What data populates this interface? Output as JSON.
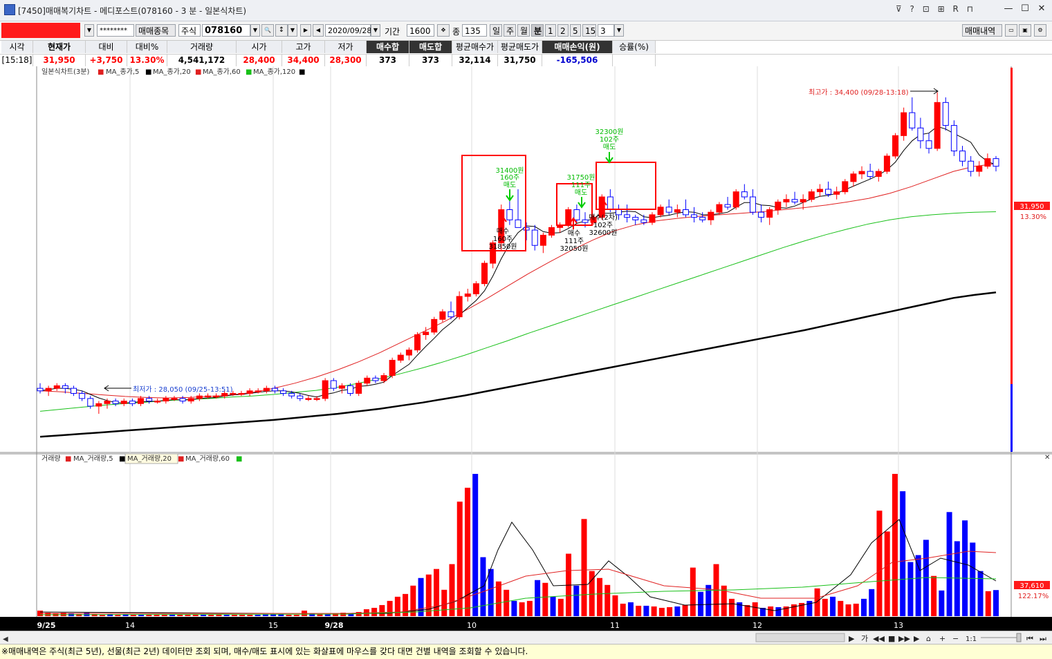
{
  "window": {
    "title": "[7450]매매복기차트 - 메디포스트(078160 - 3 분 - 일본식차트)",
    "icons": "⊽ ? ⊡ ⊞ R ⊓"
  },
  "toolbar": {
    "password": "********",
    "trade_items_btn": "매매종목",
    "market_select": "주식",
    "stock_code": "078160",
    "date": "2020/09/28",
    "period_label": "기간",
    "period_value": "1600",
    "count_label": "종",
    "count_value": "135",
    "period_buttons": [
      "일",
      "주",
      "월",
      "분",
      "1",
      "2",
      "5",
      "15"
    ],
    "interval_value": "3",
    "trade_history_btn": "매매내역"
  },
  "info": {
    "headers": [
      "시각",
      "현재가",
      "대비",
      "대비%",
      "거래량",
      "시가",
      "고가",
      "저가",
      "매수합",
      "매도합",
      "평균매수가",
      "평균매도가",
      "매매손익(원)",
      "승률(%)"
    ],
    "values": [
      "[15:18]",
      "31,950",
      "+3,750",
      "13.30%",
      "4,541,172",
      "28,400",
      "34,400",
      "28,300",
      "373",
      "373",
      "32,114",
      "31,750",
      "-165,506",
      ""
    ]
  },
  "price_legend": {
    "title": "일본식차트(3분)",
    "items": [
      "MA_종가,5",
      "MA_종가,20",
      "MA_종가,60",
      "MA_종가,120"
    ]
  },
  "volume_legend": {
    "title": "거래량",
    "items": [
      "MA_거래량,5",
      "MA_거래량,20",
      "MA_거래량,60"
    ]
  },
  "annotations": {
    "high": "최고가 : 34,400 (09/28-13:18)",
    "low": "최저가 : 28,050 (09/25-13:51)",
    "sell1": [
      "31400원",
      "160주",
      "매도"
    ],
    "buy1": [
      "매수",
      "160주",
      "31850원"
    ],
    "sell2": [
      "31750원",
      "111주",
      "매도"
    ],
    "buy2": [
      "매수",
      "111주",
      "32050원"
    ],
    "sell3": [
      "32300원",
      "102주",
      "매도"
    ],
    "buy3": [
      "매수(2차)",
      "102주",
      "32600원"
    ]
  },
  "price_tag": {
    "value": "31,950",
    "pct": "13.30%"
  },
  "volume_tag": {
    "value": "37,610",
    "pct": "122.17%"
  },
  "time_labels": [
    "9/25",
    "14",
    "15",
    "9/28",
    "10",
    "11",
    "12",
    "13"
  ],
  "scroll": {
    "ratio": "1:1"
  },
  "footer_text": "※매매내역은 주식(최근 5년), 선물(최근 2년) 데이터만 조회 되며, 매수/매도 표시에 있는 화살표에 마우스를 갖다 대면 건별 내역을 조회할 수 있습니다.",
  "colors": {
    "up": "#ff0000",
    "down": "#0000ff",
    "ma5": "#000000",
    "ma20": "#e02020",
    "ma60": "#18c018",
    "ma120": "#000000",
    "green": "#00cc00"
  },
  "chart_data": {
    "type": "candlestick",
    "ylim": [
      27600,
      34800
    ],
    "up_color": "#ff0000",
    "down_color": "#0000ff",
    "candles": [
      [
        28600,
        28700,
        28500,
        28550
      ],
      [
        28550,
        28650,
        28450,
        28600
      ],
      [
        28600,
        28700,
        28550,
        28650
      ],
      [
        28650,
        28700,
        28500,
        28600
      ],
      [
        28600,
        28650,
        28450,
        28500
      ],
      [
        28500,
        28550,
        28350,
        28400
      ],
      [
        28400,
        28450,
        28200,
        28250
      ],
      [
        28250,
        28350,
        28100,
        28300
      ],
      [
        28300,
        28400,
        28200,
        28350
      ],
      [
        28350,
        28400,
        28250,
        28300
      ],
      [
        28300,
        28400,
        28250,
        28350
      ],
      [
        28350,
        28400,
        28250,
        28300
      ],
      [
        28300,
        28450,
        28250,
        28400
      ],
      [
        28400,
        28450,
        28300,
        28350
      ],
      [
        28350,
        28400,
        28300,
        28350
      ],
      [
        28350,
        28450,
        28300,
        28400
      ],
      [
        28400,
        28450,
        28350,
        28400
      ],
      [
        28400,
        28450,
        28300,
        28350
      ],
      [
        28350,
        28450,
        28300,
        28400
      ],
      [
        28400,
        28500,
        28350,
        28450
      ],
      [
        28450,
        28500,
        28400,
        28450
      ],
      [
        28450,
        28500,
        28400,
        28450
      ],
      [
        28450,
        28550,
        28400,
        28500
      ],
      [
        28500,
        28550,
        28450,
        28500
      ],
      [
        28500,
        28550,
        28450,
        28500
      ],
      [
        28500,
        28600,
        28450,
        28550
      ],
      [
        28550,
        28600,
        28500,
        28550
      ],
      [
        28550,
        28650,
        28500,
        28600
      ],
      [
        28600,
        28650,
        28500,
        28550
      ],
      [
        28550,
        28600,
        28450,
        28500
      ],
      [
        28500,
        28550,
        28400,
        28450
      ],
      [
        28450,
        28500,
        28350,
        28400
      ],
      [
        28400,
        28450,
        28350,
        28400
      ],
      [
        28400,
        28450,
        28350,
        28400
      ],
      [
        28400,
        28800,
        28350,
        28750
      ],
      [
        28750,
        28800,
        28550,
        28600
      ],
      [
        28600,
        28700,
        28500,
        28650
      ],
      [
        28650,
        28700,
        28450,
        28500
      ],
      [
        28500,
        28750,
        28450,
        28700
      ],
      [
        28700,
        28850,
        28650,
        28800
      ],
      [
        28800,
        28850,
        28700,
        28750
      ],
      [
        28750,
        28900,
        28700,
        28850
      ],
      [
        28850,
        29200,
        28800,
        29150
      ],
      [
        29150,
        29300,
        29100,
        29250
      ],
      [
        29250,
        29400,
        29150,
        29350
      ],
      [
        29350,
        29700,
        29300,
        29650
      ],
      [
        29650,
        29800,
        29550,
        29700
      ],
      [
        29700,
        30000,
        29650,
        29950
      ],
      [
        29950,
        30150,
        29900,
        30100
      ],
      [
        30100,
        30300,
        29950,
        30000
      ],
      [
        30000,
        30500,
        29950,
        30400
      ],
      [
        30400,
        30550,
        30300,
        30450
      ],
      [
        30450,
        30700,
        30400,
        30650
      ],
      [
        30650,
        31100,
        30600,
        31050
      ],
      [
        31050,
        31500,
        30950,
        31450
      ],
      [
        31450,
        32200,
        31300,
        32100
      ],
      [
        32100,
        32400,
        31800,
        31900
      ],
      [
        31900,
        32500,
        31750,
        31750
      ],
      [
        31750,
        31850,
        31500,
        31700
      ],
      [
        31700,
        31800,
        31300,
        31400
      ],
      [
        31400,
        31650,
        31250,
        31600
      ],
      [
        31600,
        31800,
        31550,
        31750
      ],
      [
        31750,
        31850,
        31650,
        31800
      ],
      [
        31800,
        32150,
        31750,
        32100
      ],
      [
        32100,
        32200,
        31850,
        31900
      ],
      [
        31900,
        32050,
        31750,
        31850
      ],
      [
        31850,
        32000,
        31800,
        31950
      ],
      [
        31950,
        32400,
        31900,
        32350
      ],
      [
        32350,
        32500,
        32050,
        32100
      ],
      [
        32100,
        32200,
        31900,
        32000
      ],
      [
        32000,
        32200,
        31850,
        31950
      ],
      [
        31950,
        32000,
        31800,
        31900
      ],
      [
        31900,
        32000,
        31800,
        31850
      ],
      [
        31850,
        32050,
        31800,
        32000
      ],
      [
        32000,
        32200,
        31950,
        32150
      ],
      [
        32150,
        32300,
        32000,
        32050
      ],
      [
        32050,
        32200,
        31950,
        32100
      ],
      [
        32100,
        32300,
        31950,
        32000
      ],
      [
        32000,
        32150,
        31850,
        31950
      ],
      [
        31950,
        32050,
        31850,
        31900
      ],
      [
        31900,
        32100,
        31800,
        32050
      ],
      [
        32050,
        32250,
        32000,
        32200
      ],
      [
        32200,
        32350,
        32100,
        32150
      ],
      [
        32150,
        32500,
        32100,
        32450
      ],
      [
        32450,
        32600,
        32300,
        32350
      ],
      [
        32350,
        32500,
        32000,
        32050
      ],
      [
        32050,
        32200,
        31850,
        31950
      ],
      [
        31950,
        32150,
        31800,
        32100
      ],
      [
        32100,
        32300,
        32000,
        32250
      ],
      [
        32250,
        32400,
        32150,
        32300
      ],
      [
        32300,
        32450,
        32200,
        32250
      ],
      [
        32250,
        32400,
        32100,
        32300
      ],
      [
        32300,
        32500,
        32250,
        32450
      ],
      [
        32450,
        32600,
        32350,
        32500
      ],
      [
        32500,
        32650,
        32350,
        32400
      ],
      [
        32400,
        32550,
        32300,
        32450
      ],
      [
        32450,
        32700,
        32400,
        32650
      ],
      [
        32650,
        32850,
        32550,
        32800
      ],
      [
        32800,
        32950,
        32700,
        32850
      ],
      [
        32850,
        33000,
        32700,
        32750
      ],
      [
        32750,
        32900,
        32650,
        32850
      ],
      [
        32850,
        33200,
        32800,
        33150
      ],
      [
        33150,
        33600,
        33100,
        33550
      ],
      [
        33550,
        34100,
        33450,
        34000
      ],
      [
        34000,
        34300,
        33650,
        33700
      ],
      [
        33700,
        33900,
        33300,
        33450
      ],
      [
        33450,
        33600,
        33200,
        33300
      ],
      [
        33300,
        34400,
        33250,
        34200
      ],
      [
        34200,
        34300,
        33650,
        33750
      ],
      [
        33750,
        33850,
        33150,
        33250
      ],
      [
        33250,
        33350,
        32950,
        33050
      ],
      [
        33050,
        33150,
        32750,
        32850
      ],
      [
        32850,
        33050,
        32750,
        32950
      ],
      [
        32950,
        33200,
        32900,
        33100
      ],
      [
        33100,
        33150,
        32850,
        32950
      ]
    ],
    "ma_series": [
      {
        "name": "MA_종가,20",
        "color": "#e02020",
        "values": [
          28550,
          28530,
          28500,
          28470,
          28440,
          28420,
          28410,
          28420,
          28440,
          28470,
          28520,
          28600,
          28700,
          28820,
          28960,
          29120,
          29300,
          29500,
          29700,
          29900,
          30120,
          30350,
          30600,
          30850,
          31080,
          31300,
          31500,
          31680,
          31800,
          31880,
          31930,
          31970,
          32000,
          32030,
          32060,
          32100,
          32140,
          32190,
          32250,
          32320,
          32420,
          32550,
          32700,
          32850,
          32950,
          33000
        ]
      },
      {
        "name": "MA_종가,60",
        "color": "#18c018",
        "values": [
          28150,
          28190,
          28230,
          28270,
          28300,
          28330,
          28360,
          28380,
          28400,
          28430,
          28450,
          28480,
          28520,
          28560,
          28620,
          28700,
          28790,
          28890,
          29000,
          29120,
          29250,
          29390,
          29530,
          29680,
          29820,
          29960,
          30100,
          30240,
          30380,
          30520,
          30660,
          30800,
          30940,
          31080,
          31220,
          31360,
          31490,
          31610,
          31720,
          31820,
          31900,
          31960,
          32000,
          32030,
          32050,
          32060
        ]
      },
      {
        "name": "MA_종가,120",
        "color": "#000000",
        "values": [
          27650,
          27680,
          27710,
          27740,
          27770,
          27800,
          27830,
          27860,
          27890,
          27920,
          27950,
          27980,
          28020,
          28060,
          28100,
          28150,
          28200,
          28260,
          28320,
          28390,
          28460,
          28540,
          28620,
          28700,
          28780,
          28860,
          28940,
          29020,
          29100,
          29180,
          29260,
          29340,
          29420,
          29500,
          29580,
          29660,
          29740,
          29830,
          29920,
          30010,
          30100,
          30190,
          30280,
          30370,
          30430,
          30480
        ]
      }
    ],
    "volume": {
      "ylim": [
        0,
        210000
      ],
      "values": [
        8000,
        5000,
        4000,
        5000,
        4000,
        3000,
        5000,
        3000,
        2000,
        3000,
        2000,
        3000,
        2000,
        2000,
        2000,
        2000,
        2000,
        2000,
        2000,
        2000,
        3000,
        2000,
        2000,
        3000,
        2000,
        2000,
        2000,
        2000,
        2000,
        3000,
        3000,
        3000,
        2000,
        2000,
        8000,
        4000,
        3000,
        3000,
        4000,
        5000,
        4000,
        6000,
        10000,
        12000,
        16000,
        22000,
        28000,
        32000,
        44000,
        55000,
        60000,
        68000,
        38000,
        75000,
        165000,
        185000,
        205000,
        85000,
        68000,
        50000,
        38000,
        22000,
        20000,
        22000,
        52000,
        48000,
        28000,
        25000,
        90000,
        44000,
        140000,
        65000,
        55000,
        45000,
        30000,
        18000,
        20000,
        15000,
        15000,
        14000,
        12000,
        13000,
        14000,
        16000,
        70000,
        35000,
        45000,
        75000,
        44000,
        25000,
        20000,
        16000,
        20000,
        12000,
        14000,
        13000,
        14000,
        17000,
        19000,
        22000,
        40000,
        25000,
        28000,
        22000,
        17000,
        18000,
        25000,
        39000,
        152000,
        122000,
        205000,
        180000,
        78000,
        88000,
        110000,
        58000,
        37000,
        150000,
        108000,
        138000,
        106000,
        65000,
        36000,
        37610
      ],
      "up": [
        1,
        1,
        1,
        1,
        0,
        1,
        0,
        1,
        1,
        0,
        1,
        0,
        1,
        0,
        1,
        1,
        1,
        0,
        1,
        1,
        1,
        0,
        1,
        1,
        0,
        1,
        1,
        1,
        0,
        0,
        0,
        0,
        1,
        1,
        1,
        0,
        1,
        0,
        1,
        1,
        0,
        1,
        1,
        1,
        1,
        1,
        1,
        1,
        1,
        0,
        1,
        1,
        1,
        1,
        1,
        1,
        0,
        0,
        0,
        1,
        1,
        0,
        1,
        1,
        0,
        1,
        0,
        1,
        1,
        0,
        1,
        1,
        1,
        1,
        1,
        1,
        0,
        1,
        0,
        1,
        1,
        1,
        0,
        1,
        1,
        0,
        0,
        1,
        1,
        1,
        0,
        1,
        1,
        0,
        1,
        0,
        1,
        1,
        1,
        0,
        1,
        1,
        0,
        1,
        1,
        1,
        0,
        0,
        1,
        1,
        1,
        0,
        0,
        0,
        0,
        1,
        0,
        0,
        0,
        0,
        0,
        0,
        1,
        0
      ]
    }
  }
}
